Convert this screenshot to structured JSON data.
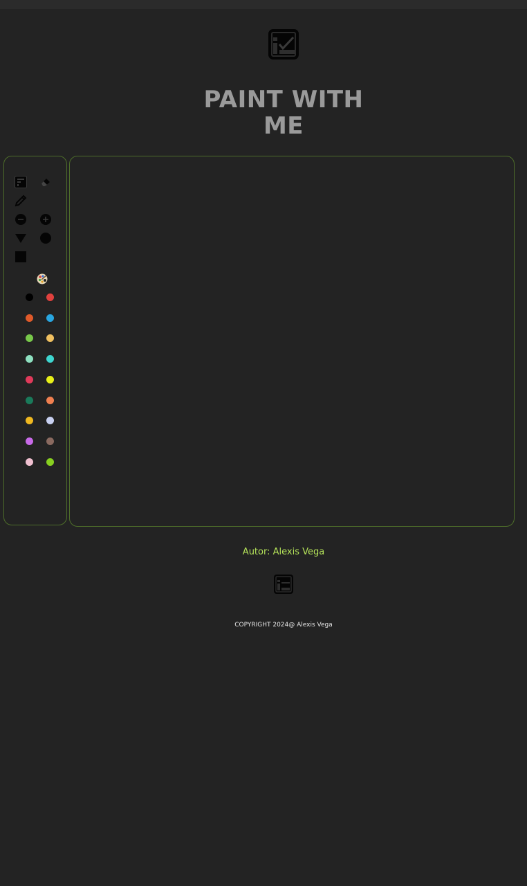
{
  "header": {
    "title": "PAINT WITH ME",
    "logo_icon": "paint-board-icon"
  },
  "tools": [
    {
      "name": "new-canvas-tool",
      "icon": "board-icon"
    },
    {
      "name": "eraser-tool",
      "icon": "eraser-icon"
    },
    {
      "name": "pencil-tool",
      "icon": "pencil-icon"
    },
    {
      "name": "decrease-size-tool",
      "icon": "minus-circle-icon"
    },
    {
      "name": "increase-size-tool",
      "icon": "plus-circle-icon"
    },
    {
      "name": "triangle-tool",
      "icon": "triangle-icon"
    },
    {
      "name": "circle-tool",
      "icon": "circle-icon"
    },
    {
      "name": "square-tool",
      "icon": "square-icon"
    }
  ],
  "palette": {
    "icon": "palette-icon",
    "colors": [
      "#000000",
      "#e0413e",
      "#e05a2a",
      "#29a6e0",
      "#78c84a",
      "#f0c060",
      "#8ee0c0",
      "#3ed6cf",
      "#e03a5a",
      "#e8f018",
      "#1a7a5a",
      "#f08050",
      "#f0b820",
      "#c8d0f0",
      "#c86ae8",
      "#8a6a60",
      "#f0c0d0",
      "#88d020"
    ]
  },
  "footer": {
    "author": "Autor: Alexis Vega",
    "copyright": "COPYRIGHT 2024@ Alexis Vega",
    "logo_icon": "paint-board-icon"
  },
  "colors": {
    "background": "#232323",
    "border": "#4e6e2a",
    "title": "#9a9a9a",
    "author": "#b5e35a"
  }
}
